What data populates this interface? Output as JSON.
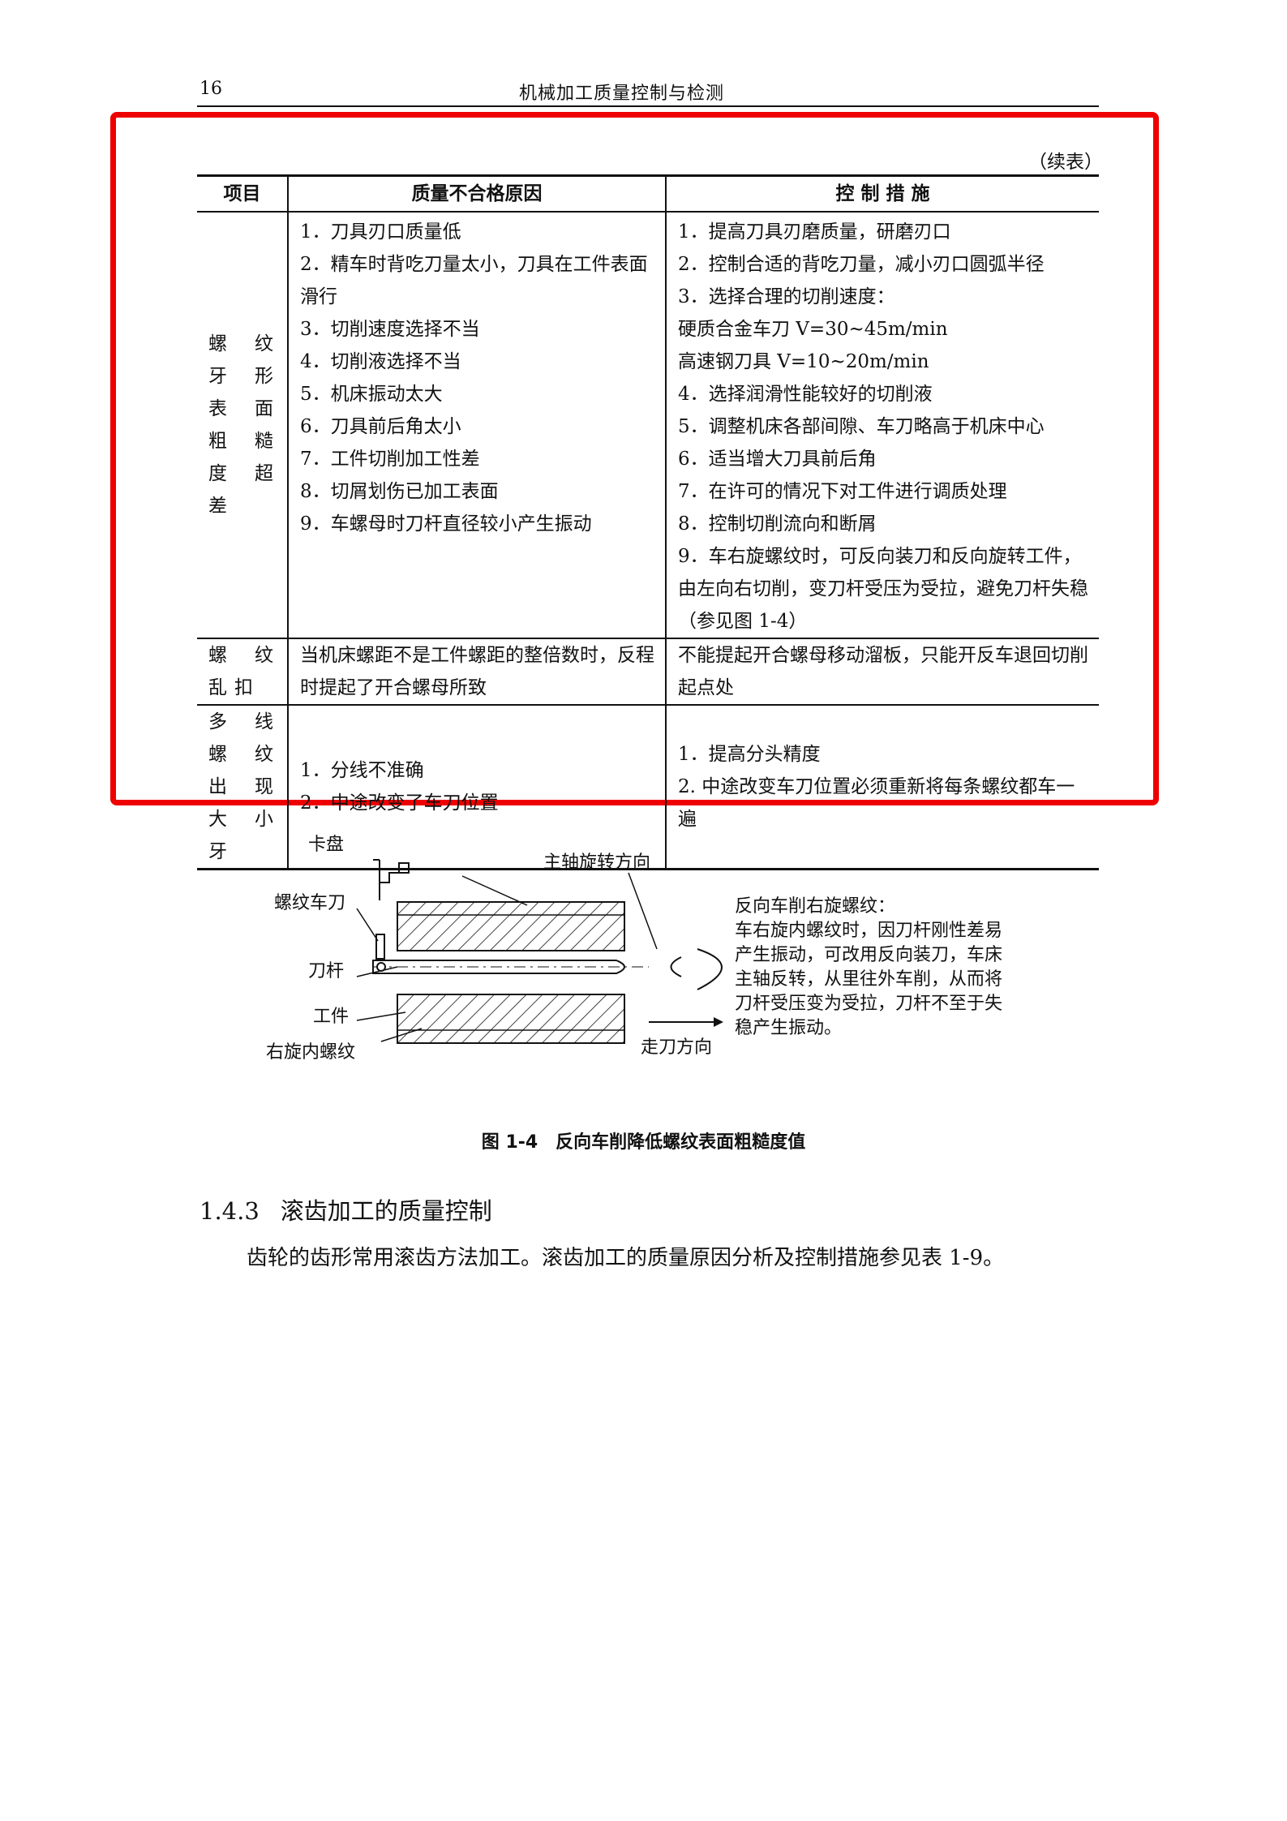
{
  "header": {
    "page_number": "16",
    "title": "机械加工质量控制与检测"
  },
  "table": {
    "continued_label": "（续表）",
    "columns": [
      "项目",
      "质量不合格原因",
      "控 制 措 施"
    ],
    "rows": [
      {
        "item": "螺纹牙形表面粗糙度超差",
        "causes": [
          "1．刀具刃口质量低",
          "2．精车时背吃刀量太小，刀具在工件表面滑行",
          "3．切削速度选择不当",
          "4．切削液选择不当",
          "5．机床振动太大",
          "6．刀具前后角太小",
          "7．工件切削加工性差",
          "8．切屑划伤已加工表面",
          "9．车螺母时刀杆直径较小产生振动"
        ],
        "measures": [
          "1．提高刀具刃磨质量，研磨刃口",
          "2．控制合适的背吃刀量，减小刃口圆弧半径",
          "3．选择合理的切削速度：",
          "硬质合金车刀 V=30~45m/min",
          "高速钢刀具 V=10~20m/min",
          "4．选择润滑性能较好的切削液",
          "5．调整机床各部间隙、车刀略高于机床中心",
          "6．适当增大刀具前后角",
          "7．在许可的情况下对工件进行调质处理",
          "8．控制切削流向和断屑",
          "9．车右旋螺纹时，可反向装刀和反向旋转工件，由左向右切削，变刀杆受压为受拉，避免刀杆失稳（参见图 1-4）"
        ]
      },
      {
        "item": "螺纹乱扣",
        "causes": [
          "当机床螺距不是工件螺距的整倍数时，反程时提起了开合螺母所致"
        ],
        "measures": [
          "不能提起开合螺母移动溜板，只能开反车退回切削起点处"
        ]
      },
      {
        "item": "多线螺纹出现大小牙",
        "causes": [
          "1．分线不准确",
          "2．中途改变了车刀位置"
        ],
        "measures": [
          "1．提高分头精度",
          "2. 中途改变车刀位置必须重新将每条螺纹都车一遍"
        ]
      }
    ]
  },
  "figure": {
    "labels": {
      "chuck": "卡盘",
      "thread_tool": "螺纹车刀",
      "tool_bar": "刀杆",
      "workpiece": "工件",
      "rh_internal_thread": "右旋内螺纹",
      "spindle_direction": "主轴旋转方向",
      "feed_direction": "走刀方向"
    },
    "note_lines": [
      "反向车削右旋螺纹：",
      "车右旋内螺纹时，因刀杆刚性差易",
      "产生振动，可改用反向装刀，车床",
      "主轴反转，从里往外车削，从而将",
      "刀杆受压变为受拉，刀杆不至于失",
      "稳产生振动。"
    ],
    "caption": "图 1-4　反向车削降低螺纹表面粗糙度值"
  },
  "section": {
    "number": "1.4.3",
    "title": "滚齿加工的质量控制",
    "paragraph": "齿轮的齿形常用滚齿方法加工。滚齿加工的质量原因分析及控制措施参见表 1-9。"
  },
  "colors": {
    "highlight_border": "#ee0000",
    "text": "#111111"
  }
}
